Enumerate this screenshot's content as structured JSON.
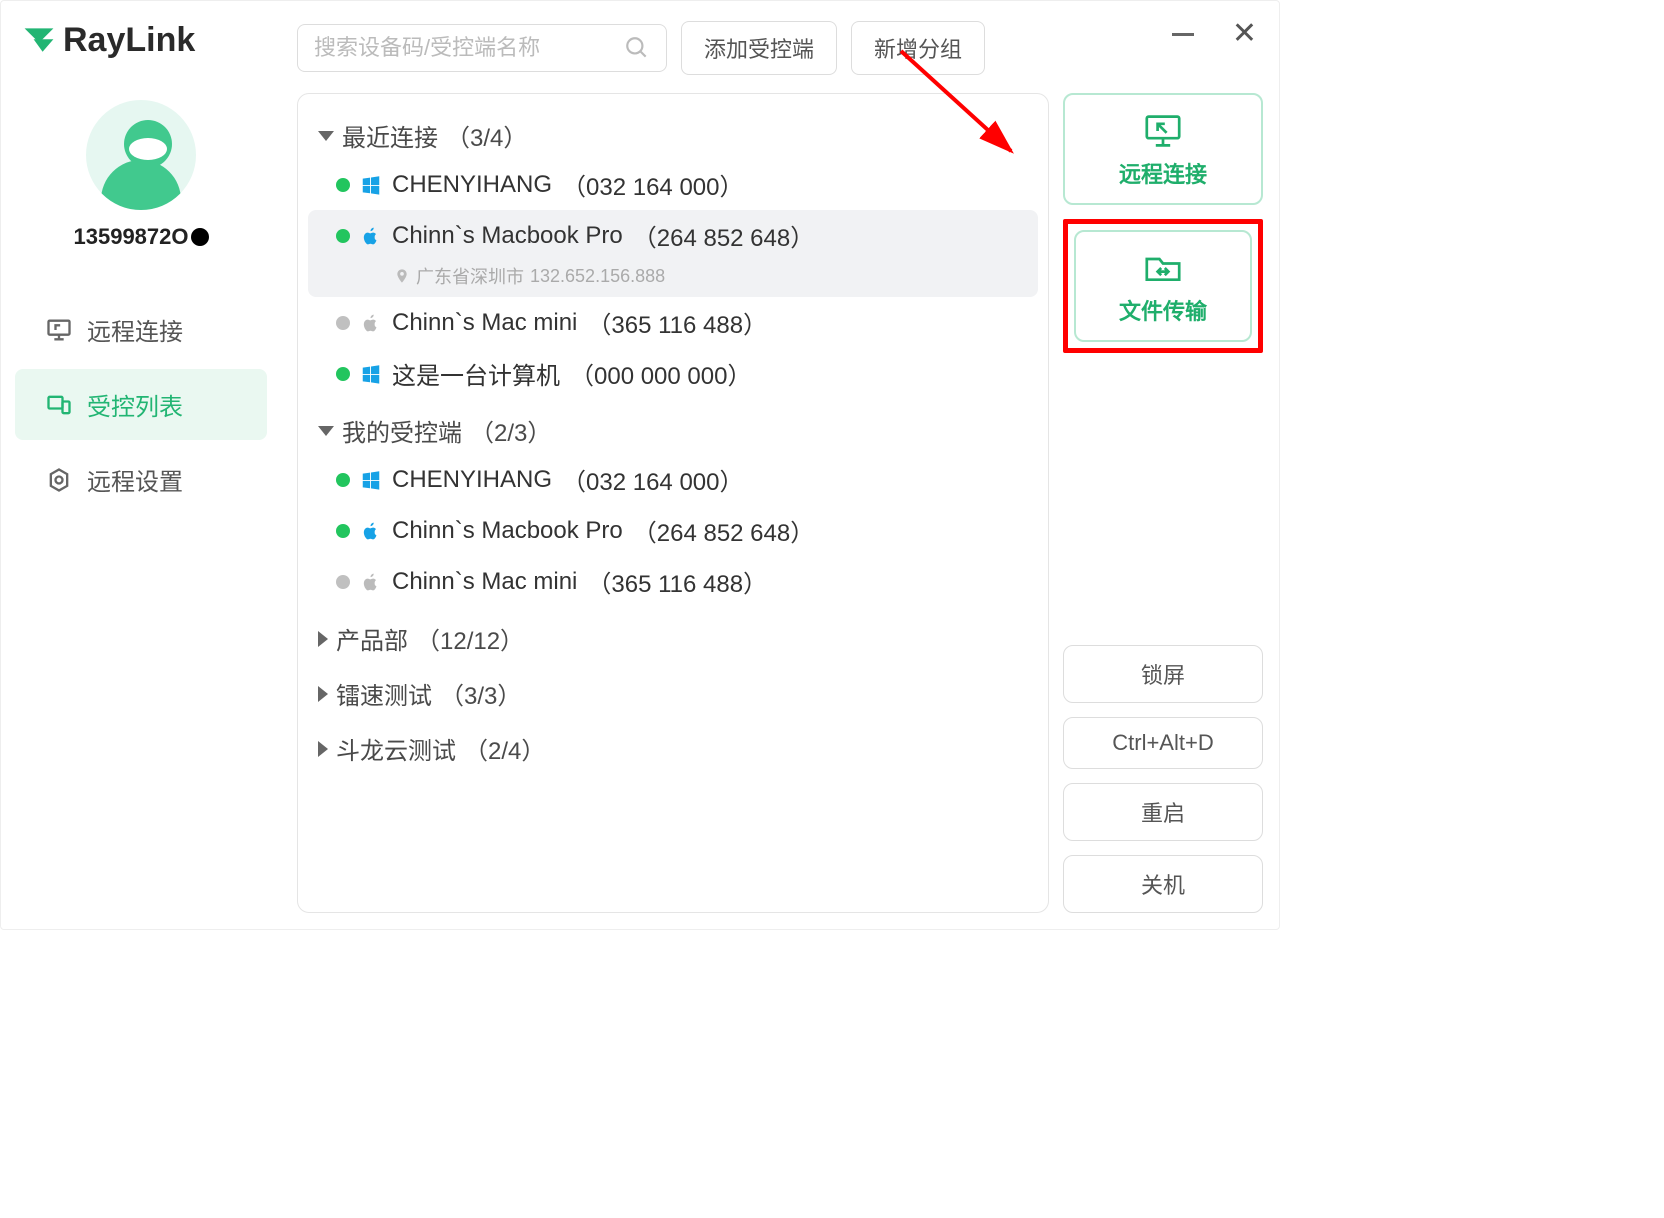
{
  "brand": "RayLink",
  "user_phone": "13599872O",
  "nav": {
    "remote_connect": "远程连接",
    "controlled_list": "受控列表",
    "remote_settings": "远程设置"
  },
  "search_placeholder": "搜索设备码/受控端名称",
  "btn_add_controlled": "添加受控端",
  "btn_new_group": "新增分组",
  "groups": {
    "recent": {
      "label": "最近连接",
      "count": "（3/4）"
    },
    "mine": {
      "label": "我的受控端",
      "count": "（2/3）"
    },
    "product": {
      "label": "产品部",
      "count": "（12/12）"
    },
    "speed": {
      "label": "镭速测试",
      "count": "（3/3）"
    },
    "doulong": {
      "label": "斗龙云测试",
      "count": "（2/4）"
    }
  },
  "devices_recent": [
    {
      "name": "CHENYIHANG",
      "id": "（032 164 000）",
      "os": "win",
      "online": true
    },
    {
      "name": "Chinn`s Macbook Pro",
      "id": "（264 852 648）",
      "os": "mac",
      "online": true,
      "selected": true,
      "loc": "广东省深圳市",
      "ip": "132.652.156.888"
    },
    {
      "name": "Chinn`s Mac mini",
      "id": "（365 116 488）",
      "os": "mac",
      "online": false
    },
    {
      "name": "这是一台计算机",
      "id": "（000 000 000）",
      "os": "win",
      "online": true
    }
  ],
  "devices_mine": [
    {
      "name": "CHENYIHANG",
      "id": "（032 164 000）",
      "os": "win",
      "online": true
    },
    {
      "name": "Chinn`s Macbook Pro",
      "id": "（264 852 648）",
      "os": "mac",
      "online": true
    },
    {
      "name": "Chinn`s Mac mini",
      "id": "（365 116 488）",
      "os": "mac",
      "online": false
    }
  ],
  "actions": {
    "remote_connect": "远程连接",
    "file_transfer": "文件传输"
  },
  "side_buttons": {
    "lock": "锁屏",
    "cad": "Ctrl+Alt+D",
    "restart": "重启",
    "shutdown": "关机"
  }
}
